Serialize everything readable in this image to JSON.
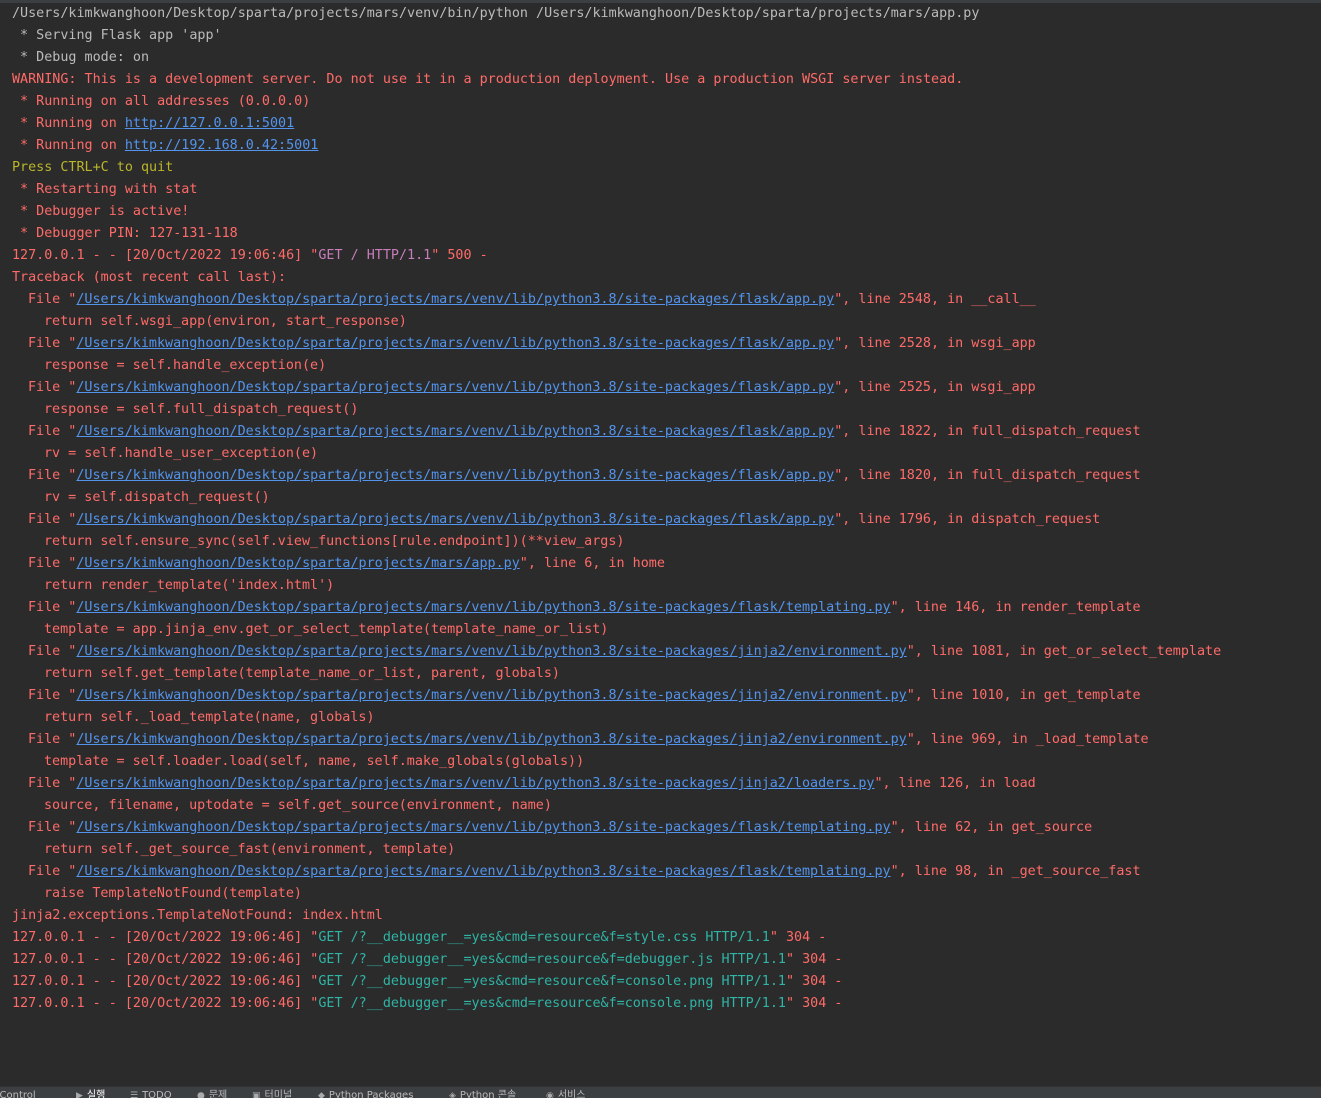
{
  "console": {
    "header": {
      "interpreter": "/Users/kimkwanghoon/Desktop/sparta/projects/mars/venv/bin/python",
      "script": "/Users/kimkwanghoon/Desktop/sparta/projects/mars/app.py"
    },
    "serving": " * Serving Flask app 'app'",
    "debug_mode": " * Debug mode: on",
    "warning": "WARNING: This is a development server. Do not use it in a production deployment. Use a production WSGI server instead.",
    "running_all": " * Running on all addresses (0.0.0.0)",
    "running_prefix": " * Running on ",
    "url_local": "http://127.0.0.1:5001",
    "url_lan": "http://192.168.0.42:5001",
    "quit_hint": "Press CTRL+C to quit",
    "restarting": " * Restarting with stat",
    "debugger_active": " * Debugger is active!",
    "debugger_pin": " * Debugger PIN: 127-131-118",
    "request_main": {
      "prefix": "127.0.0.1 - - [20/Oct/2022 19:06:46] \"",
      "request": "GET / HTTP/1.1",
      "suffix": "\" 500 -"
    },
    "traceback_header": "Traceback (most recent call last):",
    "frames": [
      {
        "path": "/Users/kimkwanghoon/Desktop/sparta/projects/mars/venv/lib/python3.8/site-packages/flask/app.py",
        "loc": "\", line 2548, in __call__",
        "code": "return self.wsgi_app(environ, start_response)"
      },
      {
        "path": "/Users/kimkwanghoon/Desktop/sparta/projects/mars/venv/lib/python3.8/site-packages/flask/app.py",
        "loc": "\", line 2528, in wsgi_app",
        "code": "response = self.handle_exception(e)"
      },
      {
        "path": "/Users/kimkwanghoon/Desktop/sparta/projects/mars/venv/lib/python3.8/site-packages/flask/app.py",
        "loc": "\", line 2525, in wsgi_app",
        "code": "response = self.full_dispatch_request()"
      },
      {
        "path": "/Users/kimkwanghoon/Desktop/sparta/projects/mars/venv/lib/python3.8/site-packages/flask/app.py",
        "loc": "\", line 1822, in full_dispatch_request",
        "code": "rv = self.handle_user_exception(e)"
      },
      {
        "path": "/Users/kimkwanghoon/Desktop/sparta/projects/mars/venv/lib/python3.8/site-packages/flask/app.py",
        "loc": "\", line 1820, in full_dispatch_request",
        "code": "rv = self.dispatch_request()"
      },
      {
        "path": "/Users/kimkwanghoon/Desktop/sparta/projects/mars/venv/lib/python3.8/site-packages/flask/app.py",
        "loc": "\", line 1796, in dispatch_request",
        "code": "return self.ensure_sync(self.view_functions[rule.endpoint])(**view_args)"
      },
      {
        "path": "/Users/kimkwanghoon/Desktop/sparta/projects/mars/app.py",
        "loc": "\", line 6, in home",
        "code": "return render_template('index.html')"
      },
      {
        "path": "/Users/kimkwanghoon/Desktop/sparta/projects/mars/venv/lib/python3.8/site-packages/flask/templating.py",
        "loc": "\", line 146, in render_template",
        "code": "template = app.jinja_env.get_or_select_template(template_name_or_list)"
      },
      {
        "path": "/Users/kimkwanghoon/Desktop/sparta/projects/mars/venv/lib/python3.8/site-packages/jinja2/environment.py",
        "loc": "\", line 1081, in get_or_select_template",
        "code": "return self.get_template(template_name_or_list, parent, globals)"
      },
      {
        "path": "/Users/kimkwanghoon/Desktop/sparta/projects/mars/venv/lib/python3.8/site-packages/jinja2/environment.py",
        "loc": "\", line 1010, in get_template",
        "code": "return self._load_template(name, globals)"
      },
      {
        "path": "/Users/kimkwanghoon/Desktop/sparta/projects/mars/venv/lib/python3.8/site-packages/jinja2/environment.py",
        "loc": "\", line 969, in _load_template",
        "code": "template = self.loader.load(self, name, self.make_globals(globals))"
      },
      {
        "path": "/Users/kimkwanghoon/Desktop/sparta/projects/mars/venv/lib/python3.8/site-packages/jinja2/loaders.py",
        "loc": "\", line 126, in load",
        "code": "source, filename, uptodate = self.get_source(environment, name)"
      },
      {
        "path": "/Users/kimkwanghoon/Desktop/sparta/projects/mars/venv/lib/python3.8/site-packages/flask/templating.py",
        "loc": "\", line 62, in get_source",
        "code": "return self._get_source_fast(environment, template)"
      },
      {
        "path": "/Users/kimkwanghoon/Desktop/sparta/projects/mars/venv/lib/python3.8/site-packages/flask/templating.py",
        "loc": "\", line 98, in _get_source_fast",
        "code": "raise TemplateNotFound(template)"
      }
    ],
    "file_prefix": "File \"",
    "exception": "jinja2.exceptions.TemplateNotFound: index.html",
    "requests": [
      {
        "prefix": "127.0.0.1 - - [20/Oct/2022 19:06:46] \"",
        "request": "GET /?__debugger__=yes&cmd=resource&f=style.css HTTP/1.1",
        "suffix": "\" 304 -"
      },
      {
        "prefix": "127.0.0.1 - - [20/Oct/2022 19:06:46] \"",
        "request": "GET /?__debugger__=yes&cmd=resource&f=debugger.js HTTP/1.1",
        "suffix": "\" 304 -"
      },
      {
        "prefix": "127.0.0.1 - - [20/Oct/2022 19:06:46] \"",
        "request": "GET /?__debugger__=yes&cmd=resource&f=console.png HTTP/1.1",
        "suffix": "\" 304 -"
      },
      {
        "prefix": "127.0.0.1 - - [20/Oct/2022 19:06:46] \"",
        "request": "GET /?__debugger__=yes&cmd=resource&f=console.png HTTP/1.1",
        "suffix": "\" 304 -"
      }
    ]
  },
  "colors": {
    "background": "#2b2b2b",
    "default_text": "#bbbbbb",
    "error_text": "#ff6b68",
    "warning_yellow": "#bbb529",
    "request_magenta": "#c77dbb",
    "request_teal": "#2fb4a5",
    "link": "#5394ec"
  },
  "statusbar": {
    "tabs": [
      {
        "label": "n Control",
        "icon": ""
      },
      {
        "label": "실행",
        "icon": "play-icon"
      },
      {
        "label": "TODO",
        "icon": "list-icon"
      },
      {
        "label": "문제",
        "icon": "problems-icon"
      },
      {
        "label": "터미널",
        "icon": "terminal-icon"
      },
      {
        "label": "Python Packages",
        "icon": "packages-icon"
      },
      {
        "label": "Python 콘솔",
        "icon": "python-icon"
      },
      {
        "label": "서비스",
        "icon": "services-icon"
      }
    ]
  }
}
